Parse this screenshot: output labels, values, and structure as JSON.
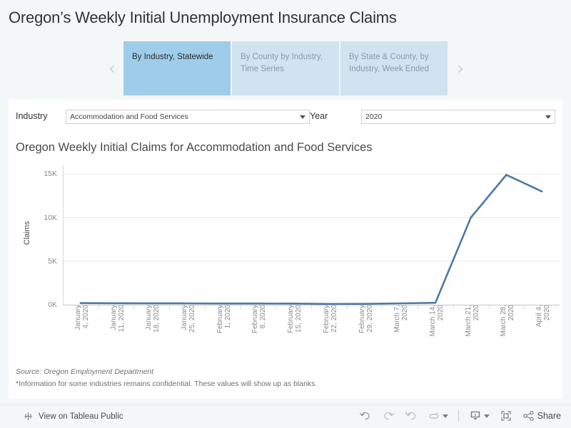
{
  "page_title": "Oregon’s Weekly Initial Unemployment Insurance Claims",
  "story_nav": {
    "prev_arrow": "‹",
    "next_arrow": "›",
    "tabs": [
      {
        "line1": "By Industry,",
        "line2": "Statewide",
        "active": true
      },
      {
        "line1": "By County by Industry,",
        "line2": "Time Series",
        "active": false
      },
      {
        "line1": "By State & County, by",
        "line2": "Industry, Week Ended",
        "active": false
      }
    ],
    "active_color": "#9fcde9",
    "inactive_color": "#cfe3f1"
  },
  "filters": {
    "industry_label": "Industry",
    "industry_value": "Accommodation and Food Services",
    "year_label": "Year",
    "year_value": "2020"
  },
  "footnotes": {
    "source": "Source: Oregon Employment Department",
    "note": "*Information for some industries remains confidential. These values will show up as blanks."
  },
  "toolbar": {
    "view_label": "View on Tableau Public",
    "tableau_logo_icon": "tableau-logo-icon",
    "undo_icon": "undo-icon",
    "redo_icon": "redo-icon",
    "revert_icon": "revert-icon",
    "refresh_icon": "refresh-icon",
    "download_icon": "download-icon",
    "fullscreen_icon": "fullscreen-icon",
    "share_icon": "share-icon",
    "share_label": "Share"
  },
  "chart_data": {
    "type": "line",
    "title": "Oregon Weekly Initial Claims for Accommodation and Food Services",
    "xlabel": "",
    "ylabel": "Claims",
    "line_color": "#4e79a7",
    "grid": true,
    "legend": "none",
    "ylim": [
      0,
      16000
    ],
    "yticks": [
      0,
      5000,
      10000,
      15000
    ],
    "ytick_labels": [
      "0K",
      "5K",
      "10K",
      "15K"
    ],
    "categories": [
      "January 4, 2020",
      "January 11, 2020",
      "January 18, 2020",
      "January 25, 2020",
      "February 1, 2020",
      "February 8, 2020",
      "February 15, 2020",
      "February 22, 2020",
      "February 29, 2020",
      "March 7, 2020",
      "March 14, 2020",
      "March 21, 2020",
      "March 28, 2020",
      "April 4, 2020"
    ],
    "category_lines": [
      [
        "January",
        "4, 2020"
      ],
      [
        "January",
        "11, 2020"
      ],
      [
        "January",
        "18, 2020"
      ],
      [
        "January",
        "25, 2020"
      ],
      [
        "February",
        "1, 2020"
      ],
      [
        "February",
        "8, 2020"
      ],
      [
        "February",
        "15, 2020"
      ],
      [
        "February",
        "22, 2020"
      ],
      [
        "February",
        "29, 2020"
      ],
      [
        "March 7,",
        "2020"
      ],
      [
        "March 14,",
        "2020"
      ],
      [
        "March 21,",
        "2020"
      ],
      [
        "March 28,",
        "2020"
      ],
      [
        "April 4,",
        "2020"
      ]
    ],
    "values": [
      200,
      180,
      170,
      160,
      150,
      150,
      140,
      100,
      110,
      160,
      230,
      10000,
      14900,
      13000
    ]
  }
}
